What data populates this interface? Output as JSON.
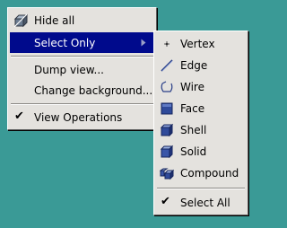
{
  "main_menu": {
    "items": [
      {
        "label": "Hide all",
        "icon": "hide-all-icon"
      },
      {
        "label": "Select Only",
        "submenu": true,
        "highlighted": true
      },
      {
        "label": "Dump view..."
      },
      {
        "label": "Change background..."
      },
      {
        "label": "View Operations",
        "checked": true
      }
    ]
  },
  "select_only_submenu": {
    "items": [
      {
        "label": "Vertex",
        "icon": "vertex-icon"
      },
      {
        "label": "Edge",
        "icon": "edge-icon"
      },
      {
        "label": "Wire",
        "icon": "wire-icon"
      },
      {
        "label": "Face",
        "icon": "face-icon"
      },
      {
        "label": "Shell",
        "icon": "shell-icon"
      },
      {
        "label": "Solid",
        "icon": "solid-icon"
      },
      {
        "label": "Compound",
        "icon": "compound-icon"
      },
      {
        "label": "Select All",
        "checked": true
      }
    ]
  },
  "colors": {
    "desktop": "#3a9a96",
    "menu_bg": "#e4e2de",
    "highlight": "#000a8c"
  }
}
